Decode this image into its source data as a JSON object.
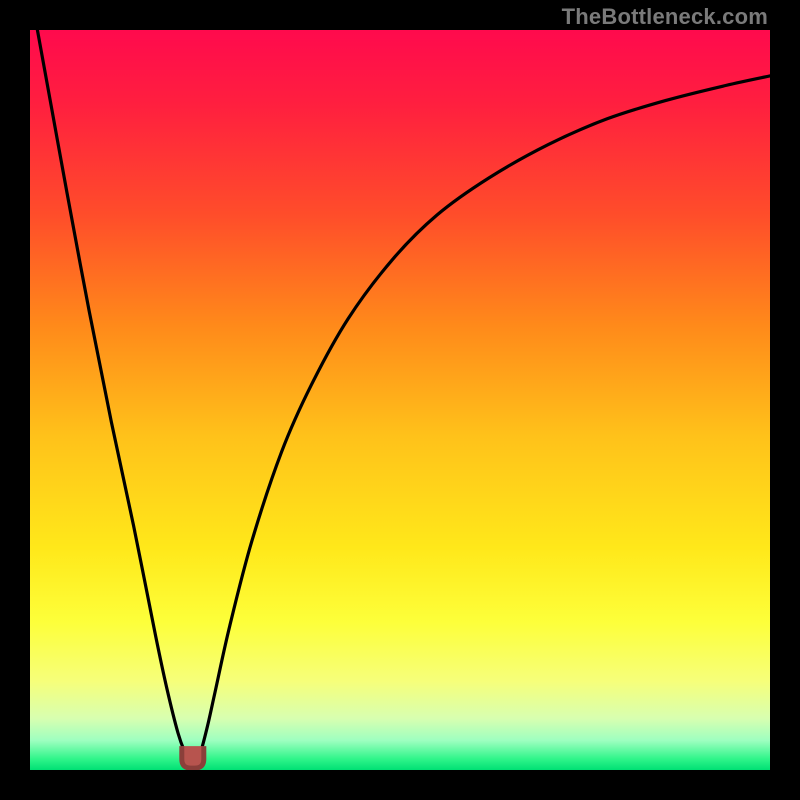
{
  "watermark": "TheBottleneck.com",
  "colors": {
    "frame": "#000000",
    "watermark": "#7a7a7a",
    "curve": "#000000",
    "cusp_marker_fill": "#b7544e",
    "cusp_marker_stroke": "#8a3f3a",
    "gradient_stops": [
      {
        "offset": 0.0,
        "color": "#ff0a4d"
      },
      {
        "offset": 0.1,
        "color": "#ff1f3f"
      },
      {
        "offset": 0.25,
        "color": "#ff4d2a"
      },
      {
        "offset": 0.4,
        "color": "#ff8a1a"
      },
      {
        "offset": 0.55,
        "color": "#ffc21a"
      },
      {
        "offset": 0.7,
        "color": "#ffe81a"
      },
      {
        "offset": 0.8,
        "color": "#fdff3a"
      },
      {
        "offset": 0.88,
        "color": "#f6ff7a"
      },
      {
        "offset": 0.93,
        "color": "#d8ffb0"
      },
      {
        "offset": 0.96,
        "color": "#9effc0"
      },
      {
        "offset": 0.985,
        "color": "#30f58a"
      },
      {
        "offset": 1.0,
        "color": "#00e074"
      }
    ]
  },
  "chart_data": {
    "type": "line",
    "title": "",
    "xlabel": "",
    "ylabel": "",
    "xlim": [
      0,
      1
    ],
    "ylim": [
      0,
      1
    ],
    "grid": false,
    "series": [
      {
        "name": "bottleneck-curve",
        "x": [
          0.01,
          0.03,
          0.05,
          0.08,
          0.11,
          0.14,
          0.17,
          0.185,
          0.2,
          0.21,
          0.215,
          0.22,
          0.225,
          0.23,
          0.24,
          0.25,
          0.27,
          0.3,
          0.34,
          0.38,
          0.43,
          0.49,
          0.55,
          0.62,
          0.7,
          0.78,
          0.86,
          0.94,
          1.0
        ],
        "y": [
          1.0,
          0.89,
          0.78,
          0.62,
          0.47,
          0.33,
          0.18,
          0.11,
          0.05,
          0.022,
          0.012,
          0.008,
          0.012,
          0.022,
          0.06,
          0.105,
          0.195,
          0.31,
          0.43,
          0.52,
          0.61,
          0.69,
          0.75,
          0.8,
          0.845,
          0.88,
          0.905,
          0.925,
          0.938
        ]
      }
    ],
    "cusp": {
      "x": 0.22,
      "y": 0.008
    }
  }
}
